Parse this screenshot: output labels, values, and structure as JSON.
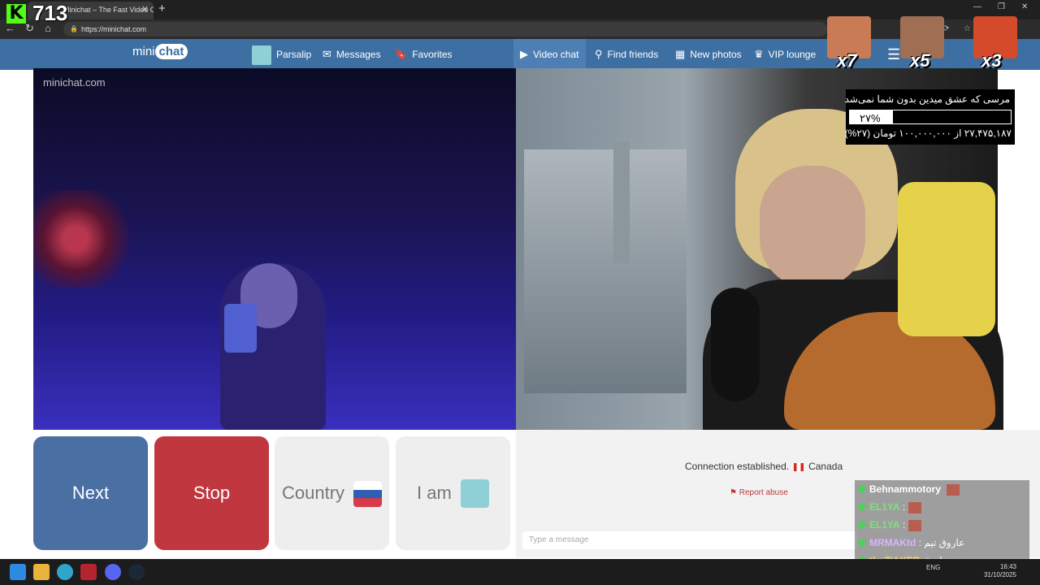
{
  "browser": {
    "tab_title": "Minichat – The Fast Video C...",
    "url": "https://minichat.com"
  },
  "overlay": {
    "viewer_count": "713",
    "emote_multipliers": [
      "x7",
      "x5",
      "x3"
    ],
    "donation": {
      "title": "مرسی که عشق میدین بدون شما نمی‌شد",
      "percent_label": "۲۷%",
      "percent_value": 27,
      "amount_text": "۲۷,۴۷۵,۱۸۷ از ۱۰۰,۰۰۰,۰۰۰ تومان (۲۷%)"
    },
    "chat": [
      {
        "user": "Behnammotory",
        "text": "",
        "color": "#ffffff",
        "emote": true
      },
      {
        "user": "EL1YA",
        "text": ":",
        "color": "#7ee07e",
        "emote": true
      },
      {
        "user": "EL1YA",
        "text": ":",
        "color": "#7ee07e",
        "emote": true
      },
      {
        "user": "MRMAKtd",
        "text": ": عاروق تیم",
        "color": "#d9b3ff",
        "emote": false
      },
      {
        "user": "theZIAXER",
        "text": "عاروق",
        "color": "#ffd966",
        "emote": false
      }
    ]
  },
  "site": {
    "logo_text_1": "mini",
    "logo_text_2": "chat",
    "watermark": "minichat.com",
    "nav": {
      "parsalip": "Parsalip",
      "messages": "Messages",
      "favorites": "Favorites",
      "video_chat": "Video chat",
      "find_friends": "Find friends",
      "new_photos": "New photos",
      "vip_lounge": "VIP lounge"
    },
    "buttons": {
      "next": "Next",
      "stop": "Stop",
      "country": "Country",
      "iam": "I am"
    },
    "connection_text": "Connection established.",
    "partner_country": "Canada",
    "report_abuse": "Report abuse",
    "message_placeholder": "Type a message"
  },
  "system": {
    "lang": "ENG",
    "time": "16:43",
    "date": "31/10/2025"
  }
}
